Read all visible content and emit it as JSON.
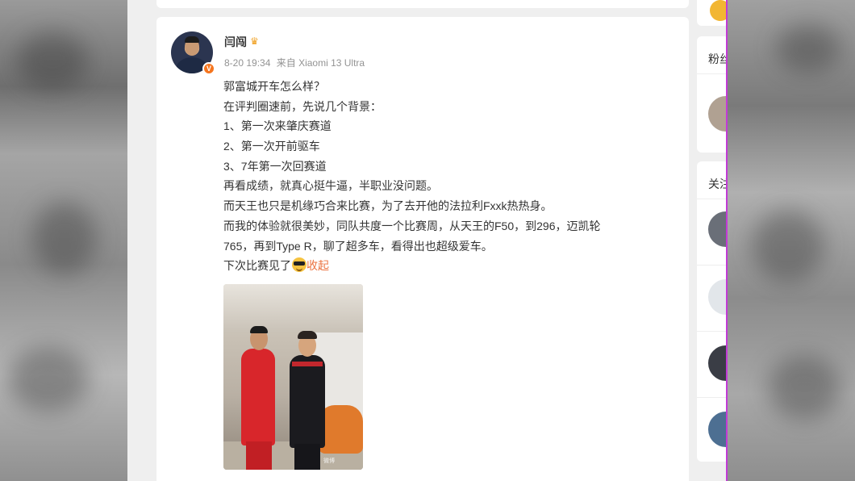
{
  "post": {
    "username": "闫闯",
    "crown_icon": "crown-icon",
    "verified_badge": "V",
    "timestamp": "8-20 19:34",
    "source": "来自 Xiaomi 13 Ultra",
    "lines": [
      "郭富城开车怎么样？",
      "在评判圈速前，先说几个背景：",
      "1、第一次来肇庆赛道",
      "2、第一次开前驱车",
      "3、7年第一次回赛道",
      "再看成绩，就真心挺牛逼，半职业没问题。",
      "而天王也只是机缘巧合来比赛，为了去开他的法拉利Fxxk热热身。",
      "而我的体验就很美妙，同队共度一个比赛周，从天王的F50，到296，迈凯轮",
      "765，再到Type R，聊了超多车，看得出也超级爱车。"
    ],
    "last_line": "下次比赛见了",
    "emoji": "sunglasses-emoji",
    "collapse_label": "收起",
    "image_watermark": "微博"
  },
  "sidebar": {
    "fans_title": "粉丝",
    "follow_title": "关注"
  }
}
